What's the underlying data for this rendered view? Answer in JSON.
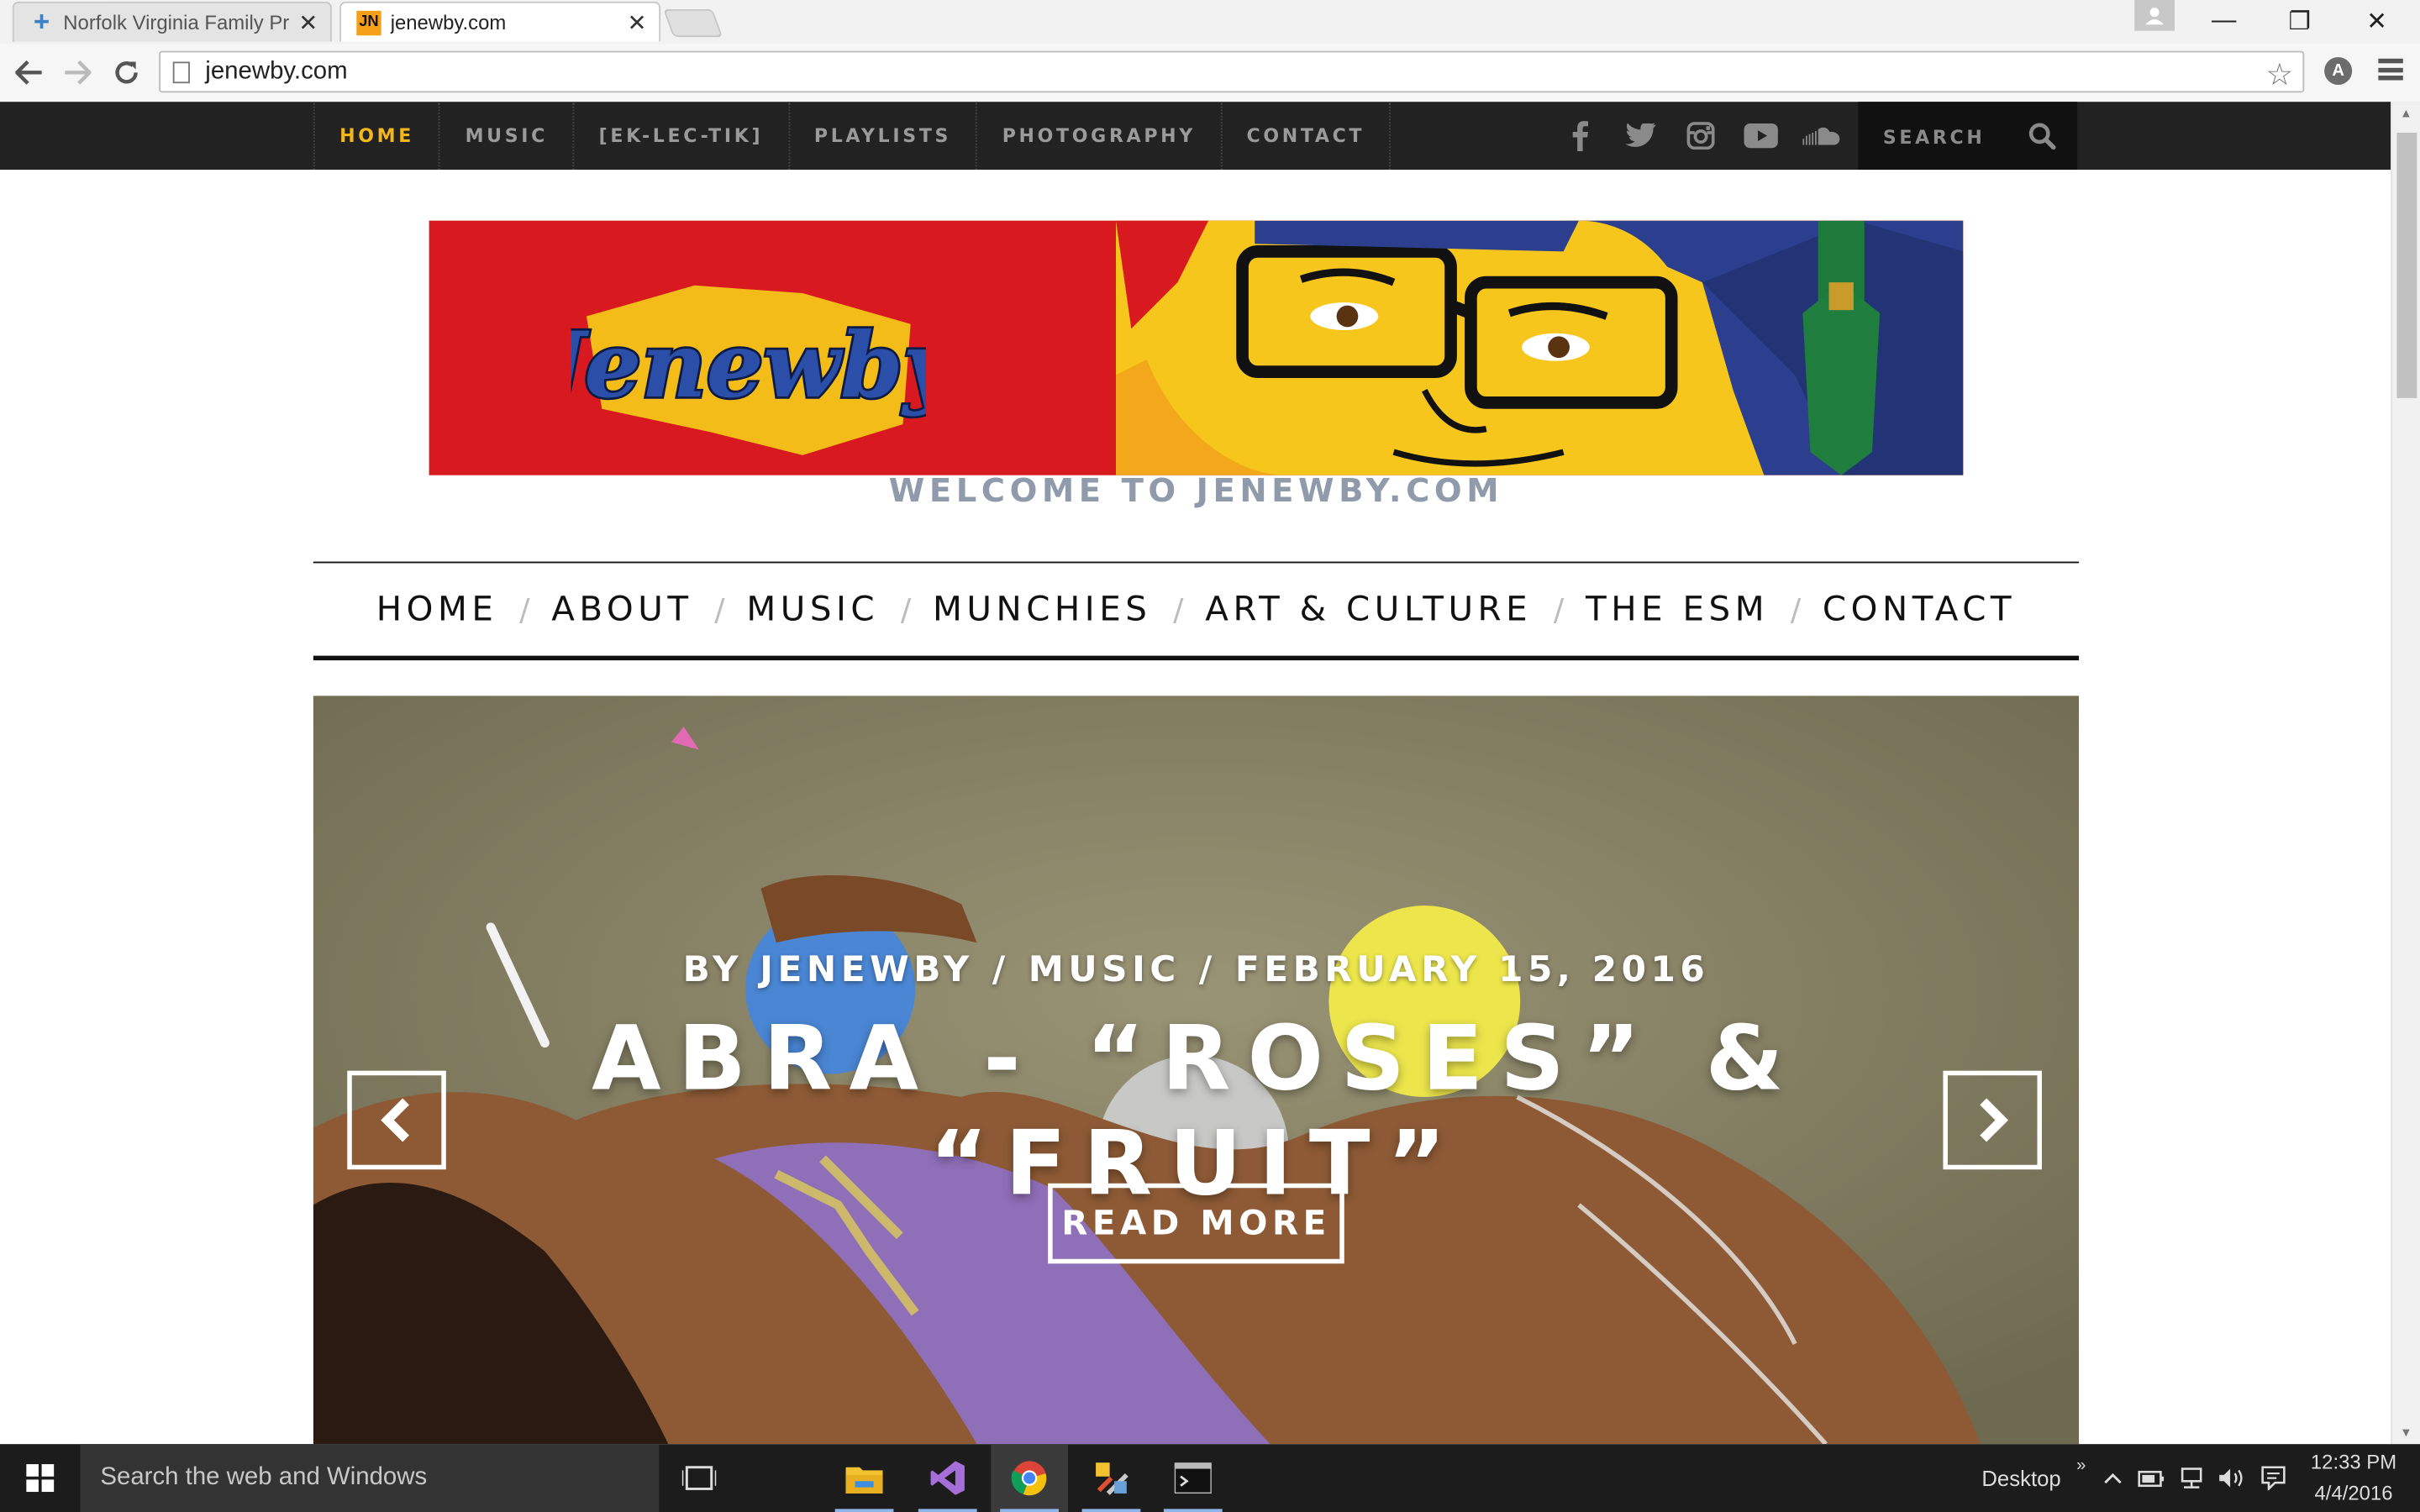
{
  "browser": {
    "tabs": [
      {
        "title": "Norfolk Virginia Family Pr",
        "active": false,
        "favicon": "plus-icon"
      },
      {
        "title": "jenewby.com",
        "active": true,
        "favicon": "JN"
      }
    ],
    "url": "jenewby.com"
  },
  "topnav": {
    "items": [
      "HOME",
      "MUSIC",
      "[EK-LEC-TIK]",
      "PLAYLISTS",
      "PHOTOGRAPHY",
      "CONTACT"
    ],
    "active_index": 0,
    "active_color": "#f2b61b",
    "social": [
      "facebook-icon",
      "twitter-icon",
      "instagram-icon",
      "youtube-icon",
      "soundcloud-icon"
    ],
    "search_placeholder": "SEARCH"
  },
  "header": {
    "logo_text": "Jenewby",
    "tagline": "WELCOME TO JENEWBY.COM"
  },
  "mainnav": {
    "items": [
      "HOME",
      "ABOUT",
      "MUSIC",
      "MUNCHIES",
      "ART & CULTURE",
      "THE ESM",
      "CONTACT"
    ],
    "separator": "/"
  },
  "slide": {
    "author": "BY JENEWBY",
    "category": "MUSIC",
    "date": "FEBRUARY 15, 2016",
    "title": "ABRA - “ROSES” & “FRUIT”",
    "button": "READ MORE"
  },
  "taskbar": {
    "search_placeholder": "Search the web and Windows",
    "desktop_label": "Desktop",
    "time": "12:33 PM",
    "date": "4/4/2016"
  }
}
